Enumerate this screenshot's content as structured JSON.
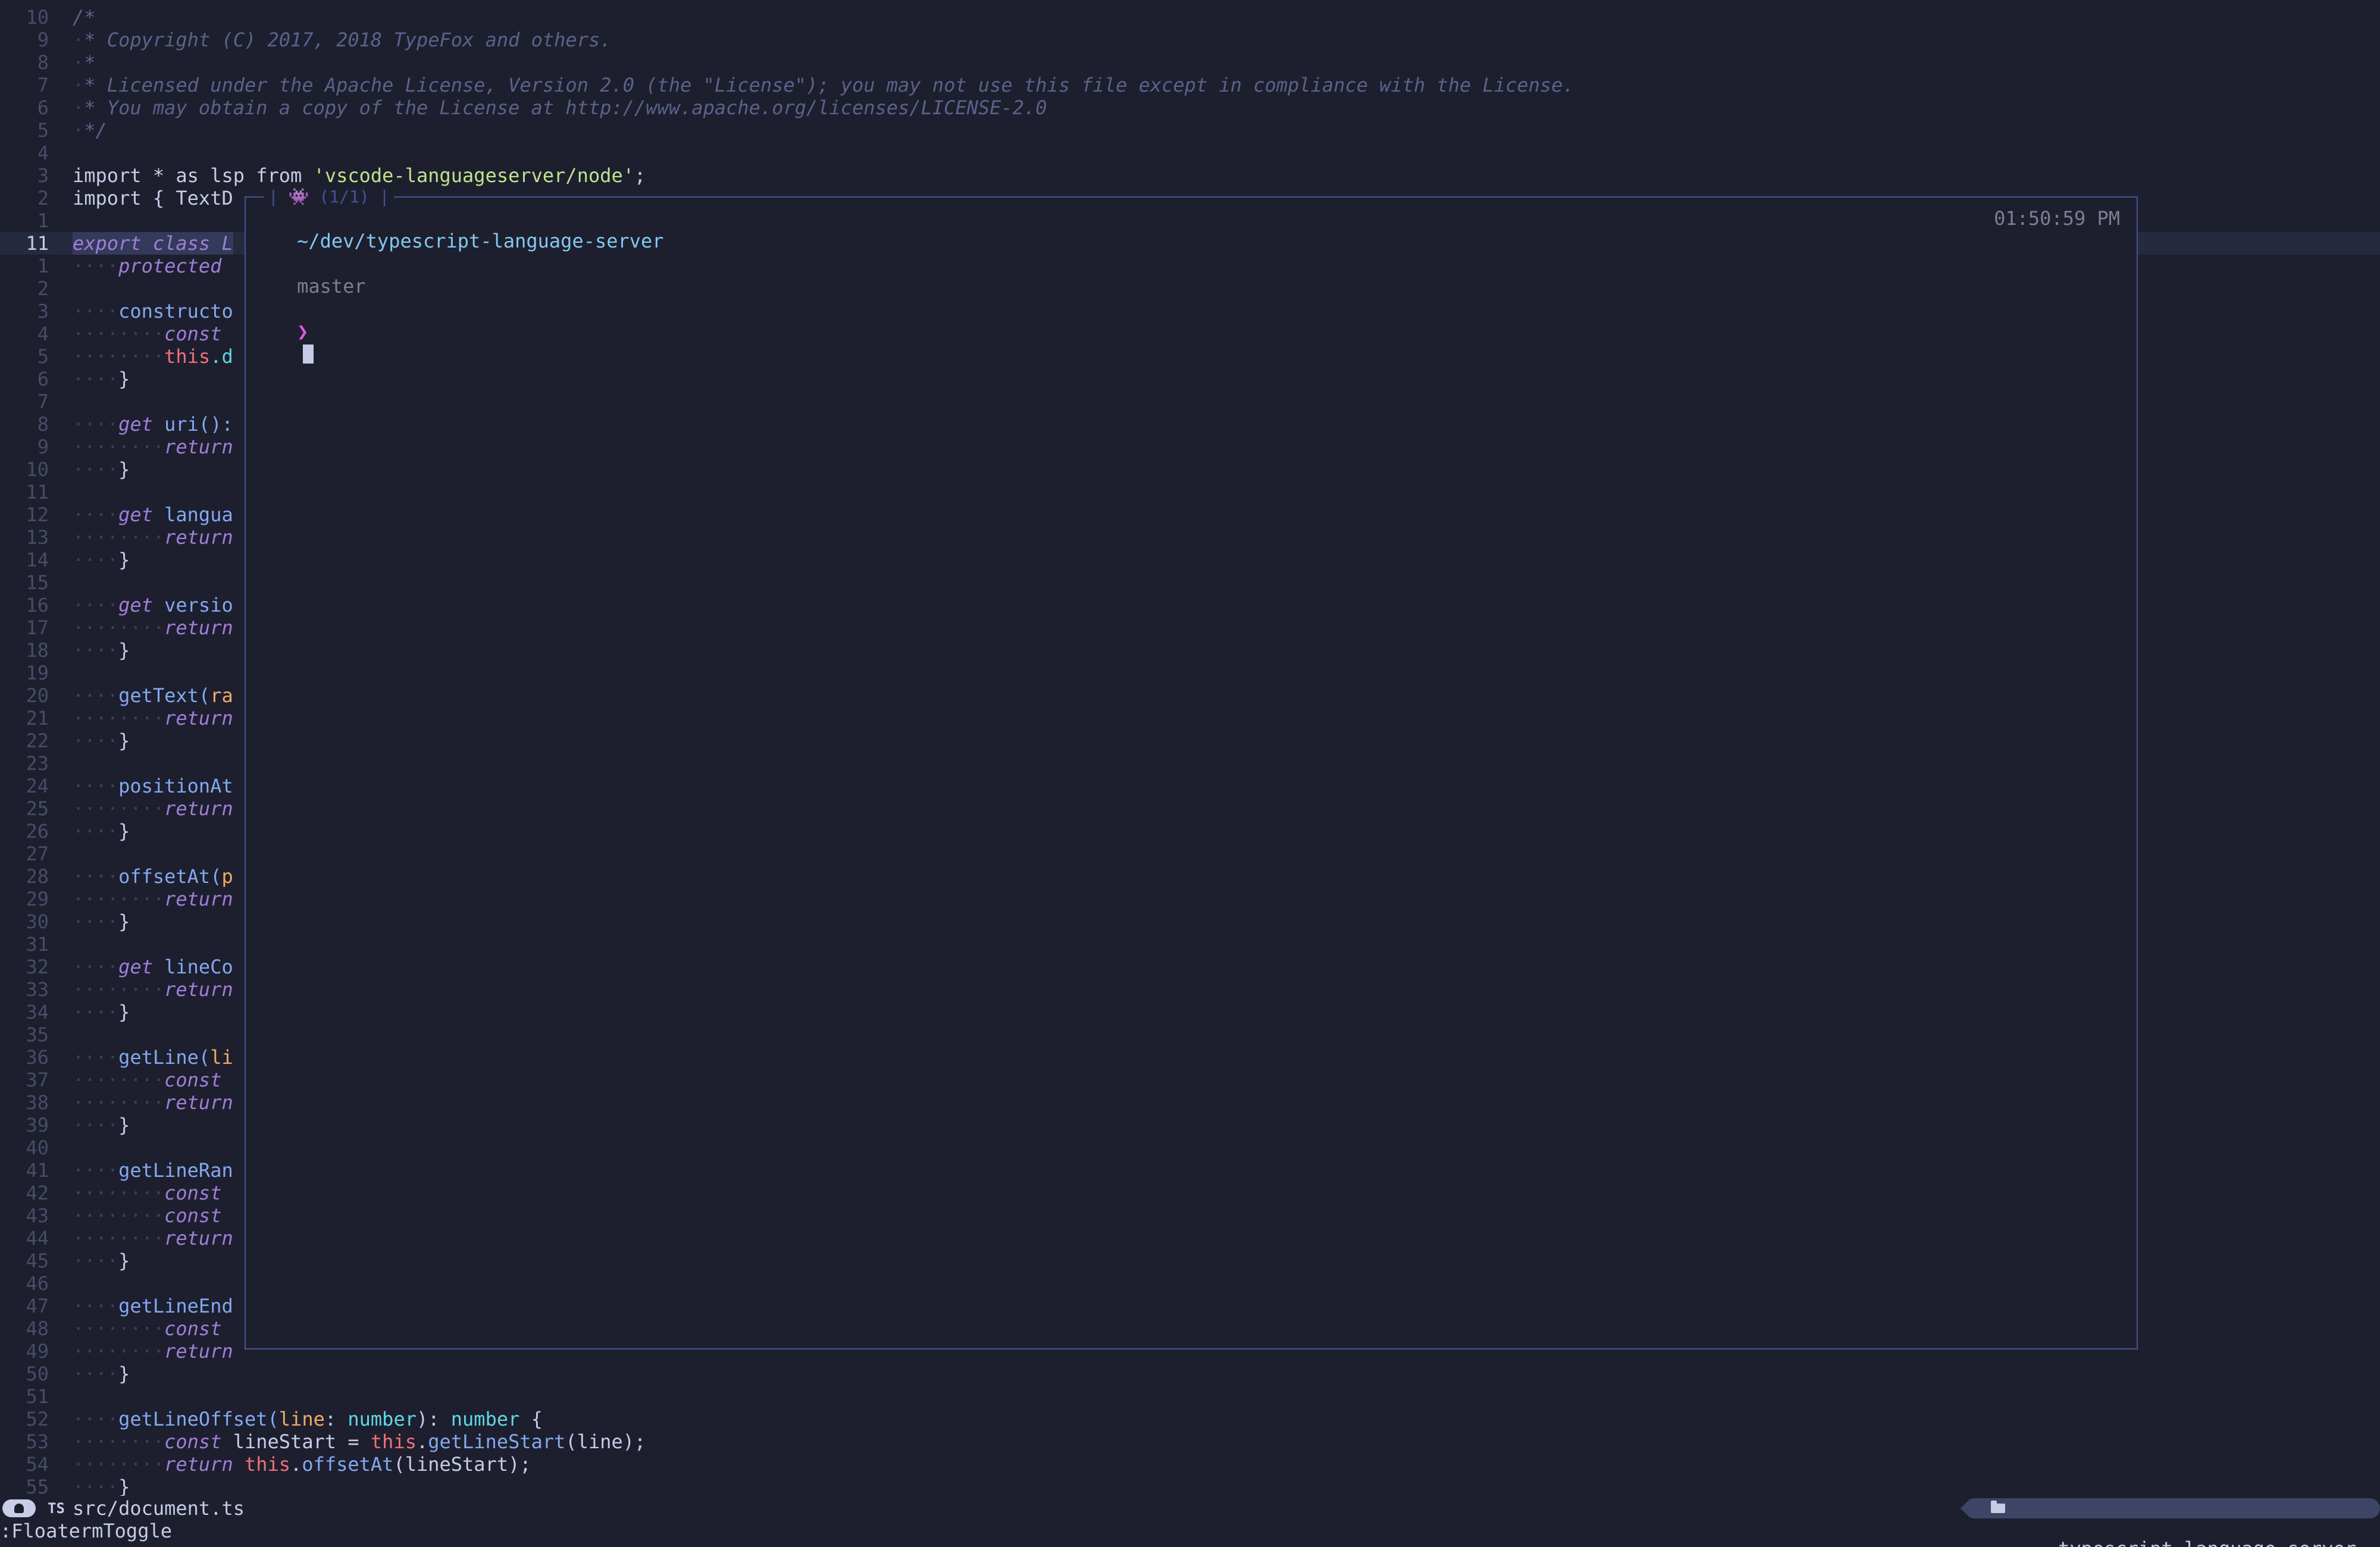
{
  "editor": {
    "current_line_index": 10,
    "lines": [
      {
        "num": "10",
        "tokens": [
          {
            "t": "/*",
            "c": "c"
          }
        ]
      },
      {
        "num": "9",
        "tokens": [
          {
            "t": "·",
            "c": "ws"
          },
          {
            "t": "* Copyright (C) 2017, 2018 TypeFox and others.",
            "c": "c"
          }
        ]
      },
      {
        "num": "8",
        "tokens": [
          {
            "t": "·",
            "c": "ws"
          },
          {
            "t": "*",
            "c": "c"
          }
        ]
      },
      {
        "num": "7",
        "tokens": [
          {
            "t": "·",
            "c": "ws"
          },
          {
            "t": "* Licensed under the Apache License, Version 2.0 (the \"License\"); you may not use this file except in compliance with the License.",
            "c": "c"
          }
        ]
      },
      {
        "num": "6",
        "tokens": [
          {
            "t": "·",
            "c": "ws"
          },
          {
            "t": "* You may obtain a copy of the License at http://www.apache.org/licenses/LICENSE-2.0",
            "c": "c"
          }
        ]
      },
      {
        "num": "5",
        "tokens": [
          {
            "t": "·",
            "c": "ws"
          },
          {
            "t": "*/",
            "c": "c"
          }
        ]
      },
      {
        "num": "4",
        "tokens": []
      },
      {
        "num": "3",
        "tokens": [
          {
            "t": "import * as lsp from ",
            "c": "id"
          },
          {
            "t": "'vscode-languageserver/node'",
            "c": "st"
          },
          {
            "t": ";",
            "c": "pn"
          }
        ]
      },
      {
        "num": "2",
        "tokens": [
          {
            "t": "import { TextD",
            "c": "id"
          }
        ]
      },
      {
        "num": "1",
        "tokens": []
      },
      {
        "num": "11",
        "tokens": [
          {
            "t": "export class L",
            "c": "kwh"
          }
        ]
      },
      {
        "num": "1",
        "tokens": [
          {
            "t": "····",
            "c": "ws"
          },
          {
            "t": "protected",
            "c": "kw"
          }
        ]
      },
      {
        "num": "2",
        "tokens": []
      },
      {
        "num": "3",
        "tokens": [
          {
            "t": "····",
            "c": "ws"
          },
          {
            "t": "constructo",
            "c": "fn"
          }
        ]
      },
      {
        "num": "4",
        "tokens": [
          {
            "t": "········",
            "c": "ws"
          },
          {
            "t": "const",
            "c": "kw"
          }
        ]
      },
      {
        "num": "5",
        "tokens": [
          {
            "t": "········",
            "c": "ws"
          },
          {
            "t": "this",
            "c": "th"
          },
          {
            "t": ".d",
            "c": "ty"
          }
        ]
      },
      {
        "num": "6",
        "tokens": [
          {
            "t": "····",
            "c": "ws"
          },
          {
            "t": "}",
            "c": "pn"
          }
        ]
      },
      {
        "num": "7",
        "tokens": []
      },
      {
        "num": "8",
        "tokens": [
          {
            "t": "····",
            "c": "ws"
          },
          {
            "t": "get",
            "c": "kw"
          },
          {
            "t": " uri():",
            "c": "fn"
          }
        ]
      },
      {
        "num": "9",
        "tokens": [
          {
            "t": "········",
            "c": "ws"
          },
          {
            "t": "return",
            "c": "kw"
          }
        ]
      },
      {
        "num": "10",
        "tokens": [
          {
            "t": "····",
            "c": "ws"
          },
          {
            "t": "}",
            "c": "pn"
          }
        ]
      },
      {
        "num": "11",
        "tokens": []
      },
      {
        "num": "12",
        "tokens": [
          {
            "t": "····",
            "c": "ws"
          },
          {
            "t": "get",
            "c": "kw"
          },
          {
            "t": " langua",
            "c": "fn"
          }
        ]
      },
      {
        "num": "13",
        "tokens": [
          {
            "t": "········",
            "c": "ws"
          },
          {
            "t": "return",
            "c": "kw"
          }
        ]
      },
      {
        "num": "14",
        "tokens": [
          {
            "t": "····",
            "c": "ws"
          },
          {
            "t": "}",
            "c": "pn"
          }
        ]
      },
      {
        "num": "15",
        "tokens": []
      },
      {
        "num": "16",
        "tokens": [
          {
            "t": "····",
            "c": "ws"
          },
          {
            "t": "get",
            "c": "kw"
          },
          {
            "t": " versio",
            "c": "fn"
          }
        ]
      },
      {
        "num": "17",
        "tokens": [
          {
            "t": "········",
            "c": "ws"
          },
          {
            "t": "return",
            "c": "kw"
          }
        ]
      },
      {
        "num": "18",
        "tokens": [
          {
            "t": "····",
            "c": "ws"
          },
          {
            "t": "}",
            "c": "pn"
          }
        ]
      },
      {
        "num": "19",
        "tokens": []
      },
      {
        "num": "20",
        "tokens": [
          {
            "t": "····",
            "c": "ws"
          },
          {
            "t": "getText(",
            "c": "fn"
          },
          {
            "t": "ra",
            "c": "par"
          }
        ]
      },
      {
        "num": "21",
        "tokens": [
          {
            "t": "········",
            "c": "ws"
          },
          {
            "t": "return",
            "c": "kw"
          }
        ]
      },
      {
        "num": "22",
        "tokens": [
          {
            "t": "····",
            "c": "ws"
          },
          {
            "t": "}",
            "c": "pn"
          }
        ]
      },
      {
        "num": "23",
        "tokens": []
      },
      {
        "num": "24",
        "tokens": [
          {
            "t": "····",
            "c": "ws"
          },
          {
            "t": "positionAt",
            "c": "fn"
          }
        ]
      },
      {
        "num": "25",
        "tokens": [
          {
            "t": "········",
            "c": "ws"
          },
          {
            "t": "return",
            "c": "kw"
          }
        ]
      },
      {
        "num": "26",
        "tokens": [
          {
            "t": "····",
            "c": "ws"
          },
          {
            "t": "}",
            "c": "pn"
          }
        ]
      },
      {
        "num": "27",
        "tokens": []
      },
      {
        "num": "28",
        "tokens": [
          {
            "t": "····",
            "c": "ws"
          },
          {
            "t": "offsetAt(",
            "c": "fn"
          },
          {
            "t": "p",
            "c": "par"
          }
        ]
      },
      {
        "num": "29",
        "tokens": [
          {
            "t": "········",
            "c": "ws"
          },
          {
            "t": "return",
            "c": "kw"
          }
        ]
      },
      {
        "num": "30",
        "tokens": [
          {
            "t": "····",
            "c": "ws"
          },
          {
            "t": "}",
            "c": "pn"
          }
        ]
      },
      {
        "num": "31",
        "tokens": []
      },
      {
        "num": "32",
        "tokens": [
          {
            "t": "····",
            "c": "ws"
          },
          {
            "t": "get",
            "c": "kw"
          },
          {
            "t": " lineCo",
            "c": "fn"
          }
        ]
      },
      {
        "num": "33",
        "tokens": [
          {
            "t": "········",
            "c": "ws"
          },
          {
            "t": "return",
            "c": "kw"
          }
        ]
      },
      {
        "num": "34",
        "tokens": [
          {
            "t": "····",
            "c": "ws"
          },
          {
            "t": "}",
            "c": "pn"
          }
        ]
      },
      {
        "num": "35",
        "tokens": []
      },
      {
        "num": "36",
        "tokens": [
          {
            "t": "····",
            "c": "ws"
          },
          {
            "t": "getLine(",
            "c": "fn"
          },
          {
            "t": "li",
            "c": "par"
          }
        ]
      },
      {
        "num": "37",
        "tokens": [
          {
            "t": "········",
            "c": "ws"
          },
          {
            "t": "const",
            "c": "kw"
          }
        ]
      },
      {
        "num": "38",
        "tokens": [
          {
            "t": "········",
            "c": "ws"
          },
          {
            "t": "return",
            "c": "kw"
          }
        ]
      },
      {
        "num": "39",
        "tokens": [
          {
            "t": "····",
            "c": "ws"
          },
          {
            "t": "}",
            "c": "pn"
          }
        ]
      },
      {
        "num": "40",
        "tokens": []
      },
      {
        "num": "41",
        "tokens": [
          {
            "t": "····",
            "c": "ws"
          },
          {
            "t": "getLineRan",
            "c": "fn"
          }
        ]
      },
      {
        "num": "42",
        "tokens": [
          {
            "t": "········",
            "c": "ws"
          },
          {
            "t": "const",
            "c": "kw"
          }
        ]
      },
      {
        "num": "43",
        "tokens": [
          {
            "t": "········",
            "c": "ws"
          },
          {
            "t": "const",
            "c": "kw"
          }
        ]
      },
      {
        "num": "44",
        "tokens": [
          {
            "t": "········",
            "c": "ws"
          },
          {
            "t": "return",
            "c": "kw"
          }
        ]
      },
      {
        "num": "45",
        "tokens": [
          {
            "t": "····",
            "c": "ws"
          },
          {
            "t": "}",
            "c": "pn"
          }
        ]
      },
      {
        "num": "46",
        "tokens": []
      },
      {
        "num": "47",
        "tokens": [
          {
            "t": "····",
            "c": "ws"
          },
          {
            "t": "getLineEnd",
            "c": "fn"
          }
        ]
      },
      {
        "num": "48",
        "tokens": [
          {
            "t": "········",
            "c": "ws"
          },
          {
            "t": "const",
            "c": "kw"
          }
        ]
      },
      {
        "num": "49",
        "tokens": [
          {
            "t": "········",
            "c": "ws"
          },
          {
            "t": "return",
            "c": "kw"
          }
        ]
      },
      {
        "num": "50",
        "tokens": [
          {
            "t": "····",
            "c": "ws"
          },
          {
            "t": "}",
            "c": "pn"
          }
        ]
      },
      {
        "num": "51",
        "tokens": []
      },
      {
        "num": "52",
        "tokens": [
          {
            "t": "····",
            "c": "ws"
          },
          {
            "t": "getLineOffset(",
            "c": "fn"
          },
          {
            "t": "line",
            "c": "par"
          },
          {
            "t": ": ",
            "c": "pn"
          },
          {
            "t": "number",
            "c": "ty"
          },
          {
            "t": "): ",
            "c": "pn"
          },
          {
            "t": "number",
            "c": "ty"
          },
          {
            "t": " {",
            "c": "pn"
          }
        ]
      },
      {
        "num": "53",
        "tokens": [
          {
            "t": "········",
            "c": "ws"
          },
          {
            "t": "const",
            "c": "kw"
          },
          {
            "t": " lineStart = ",
            "c": "id"
          },
          {
            "t": "this",
            "c": "th"
          },
          {
            "t": ".",
            "c": "pn"
          },
          {
            "t": "getLineStart",
            "c": "fn"
          },
          {
            "t": "(line);",
            "c": "id"
          }
        ]
      },
      {
        "num": "54",
        "tokens": [
          {
            "t": "········",
            "c": "ws"
          },
          {
            "t": "return",
            "c": "kw"
          },
          {
            "t": " ",
            "c": "id"
          },
          {
            "t": "this",
            "c": "th"
          },
          {
            "t": ".",
            "c": "pn"
          },
          {
            "t": "offsetAt",
            "c": "fn"
          },
          {
            "t": "(lineStart);",
            "c": "id"
          }
        ]
      },
      {
        "num": "55",
        "tokens": [
          {
            "t": "····",
            "c": "ws"
          },
          {
            "t": "}",
            "c": "pn"
          }
        ]
      }
    ]
  },
  "floaterm": {
    "title": "| 👾 (1/1) |",
    "prompt_path": "~/dev/typescript-language-server",
    "prompt_branch": "master",
    "prompt_symbol": "❯",
    "time": "01:50:59 PM"
  },
  "statusbar": {
    "filetype_icon": "TS",
    "file_path": "src/document.ts",
    "project_name": "typescript-language-server"
  },
  "cmdline": {
    "text": ":FloatermToggle"
  }
}
